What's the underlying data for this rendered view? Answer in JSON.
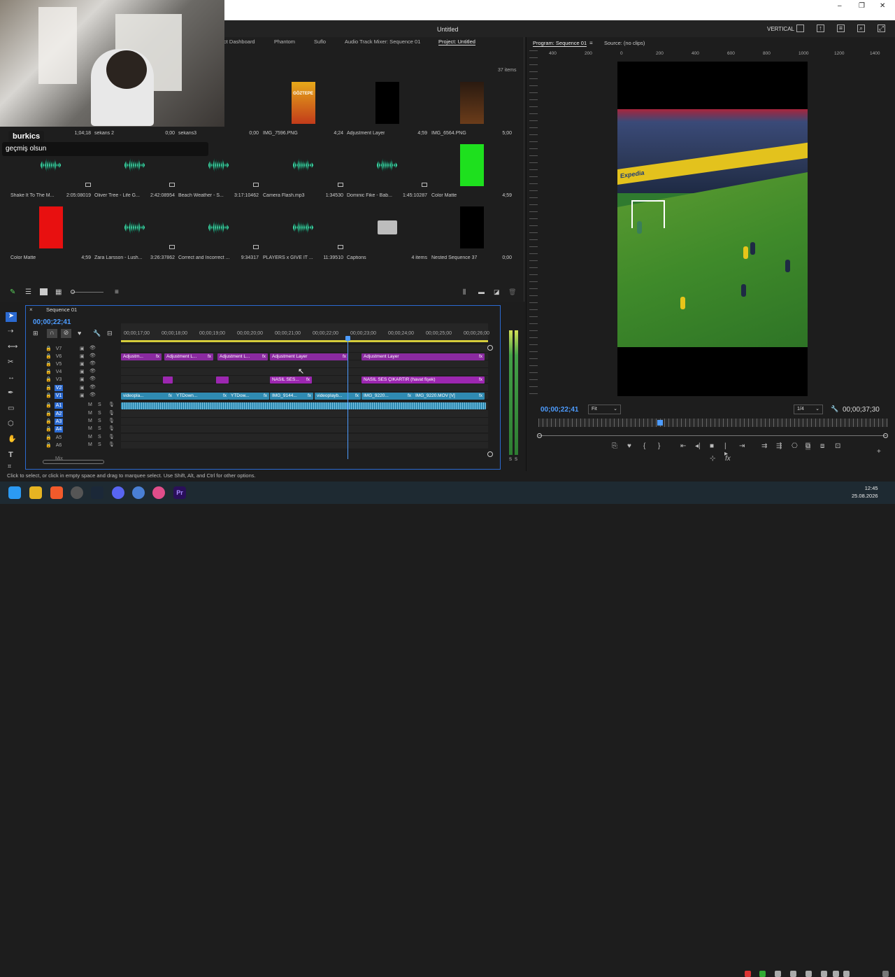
{
  "window": {
    "minimize": "–",
    "maximize": "❐",
    "close": "✕"
  },
  "header": {
    "title": "Untitled",
    "workspace": "VERTICAL"
  },
  "chat": {
    "username": "burkics",
    "message": "geçmiş olsun"
  },
  "project": {
    "tabs": [
      "ct Dashboard",
      "Phantom",
      "Suflo",
      "Audio Track Mixer: Sequence 01",
      "Project: Untitled"
    ],
    "item_count": "37 items",
    "items": [
      {
        "name": "",
        "dur": "1;04;18",
        "kind": "webcam-hidden"
      },
      {
        "name": "sekans 2",
        "dur": "0;00",
        "kind": "seq"
      },
      {
        "name": "sekans3",
        "dur": "0;00",
        "kind": "seq"
      },
      {
        "name": "IMG_7596.PNG",
        "dur": "4;24",
        "kind": "poster"
      },
      {
        "name": "Adjustment Layer",
        "dur": "4;59",
        "kind": "black"
      },
      {
        "name": "IMG_6564.PNG",
        "dur": "5;00",
        "kind": "poster2"
      },
      {
        "name": "Shake It To The M...",
        "dur": "2:05:08019",
        "kind": "audio"
      },
      {
        "name": "Oliver Tree - Life G...",
        "dur": "2:42:08954",
        "kind": "audio"
      },
      {
        "name": "Beach Weather - S...",
        "dur": "3:17:10462",
        "kind": "audio"
      },
      {
        "name": "Camera Flash.mp3",
        "dur": "1:34530",
        "kind": "audio"
      },
      {
        "name": "Dominic Fike - Bab...",
        "dur": "1:45:10287",
        "kind": "audio"
      },
      {
        "name": "Color Matte",
        "dur": "4;59",
        "kind": "green"
      },
      {
        "name": "Color Matte",
        "dur": "4;59",
        "kind": "red"
      },
      {
        "name": "Zara Larsson - Lush...",
        "dur": "3:26:37862",
        "kind": "audio"
      },
      {
        "name": "Correct and Incorrect ...",
        "dur": "9:34317",
        "kind": "audio"
      },
      {
        "name": "PLAYERS x GIVE IT ...",
        "dur": "11:39510",
        "kind": "audio"
      },
      {
        "name": "Captions",
        "dur": "4 items",
        "kind": "folder"
      },
      {
        "name": "Nested Sequence 37",
        "dur": "0;00",
        "kind": "black"
      }
    ],
    "poster_text": "GÖZTEPE"
  },
  "timeline": {
    "tab": "Sequence 01",
    "timecode": "00;00;22;41",
    "ruler": [
      "00;00;17;00",
      "00;00;18;00",
      "00;00;19;00",
      "00;00;20;00",
      "00;00;21;00",
      "00;00;22;00",
      "00;00;23;00",
      "00;00;24;00",
      "00;00;25;00",
      "00;00;26;00"
    ],
    "tracks": [
      "V7",
      "V6",
      "V5",
      "V4",
      "V3",
      "V2",
      "V1",
      "A1",
      "A2",
      "A3",
      "A4",
      "A5",
      "A6"
    ],
    "mix_label": "Mix",
    "clips": {
      "adj1": "Adjustm...",
      "adj2": "Adjustment L...",
      "adj3": "Adjustment L...",
      "adj4": "Adjustment Layer",
      "adj5": "Adjustment Layer",
      "nasil1": "NASIL SES...",
      "nasil2": "NASIL SES ÇIKARTIR (havat fişek)",
      "v1a": "videopla...",
      "v1b": "YTDown...",
      "v1c": "YTDow...",
      "v1d": "IMG_9144...",
      "v1e": "videoplayb...",
      "v1f": "IMG_9220...",
      "v1g": "IMG_9220.MOV [V]",
      "fx": "fx"
    },
    "meter_labels": [
      "S",
      "S"
    ]
  },
  "program": {
    "tab": "Program: Sequence 01",
    "source_tab": "Source: (no clips)",
    "ruler": [
      "400",
      "200",
      "0",
      "200",
      "400",
      "600",
      "800",
      "1000",
      "1200",
      "1400"
    ],
    "timecode": "00;00;22;41",
    "fit": "Fit",
    "quality": "1/4",
    "duration": "00;00;37;30",
    "ad_text": "Expedia"
  },
  "status": "Click to select, or click in empty space and drag to marquee select. Use Shift, Alt, and Ctrl for other options.",
  "clock": {
    "time": "12:45",
    "date": "25.08.2026"
  }
}
